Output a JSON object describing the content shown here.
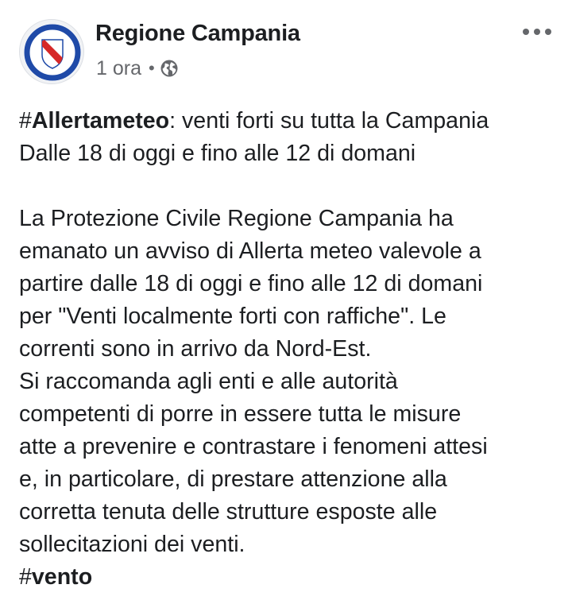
{
  "post": {
    "page_name": "Regione Campania",
    "timestamp": "1 ora",
    "separator": "•",
    "privacy_icon": "globe-icon",
    "more_icon": "more-horizontal-icon",
    "avatar_icon": "regione-campania-logo",
    "text": {
      "hashtag_1_symbol": "#",
      "hashtag_1_word": "Allertameteo",
      "line_1_rest": ": venti forti su tutta la Campania",
      "line_2": "Dalle 18 di oggi e fino alle 12 di domani",
      "paragraph_lines": [
        "La Protezione Civile Regione Campania ha",
        "emanato un avviso di Allerta meteo valevole a",
        "partire dalle 18 di oggi e fino alle 12 di domani",
        "per \"Venti localmente forti con raffiche\". Le",
        "correnti sono in arrivo da Nord-Est.",
        "Si raccomanda agli enti e alle autorità",
        "competenti di porre in essere tutta le misure",
        "atte a prevenire e contrastare i fenomeni attesi",
        "e, in particolare, di prestare attenzione alla",
        "corretta tenuta delle strutture esposte alle",
        "sollecitazioni dei venti."
      ],
      "hashtag_2_symbol": "#",
      "hashtag_2_word": "vento"
    }
  },
  "colors": {
    "text_primary": "#1c1e21",
    "text_secondary": "#65676b",
    "logo_blue": "#1f4aa8",
    "logo_red": "#d62828"
  }
}
